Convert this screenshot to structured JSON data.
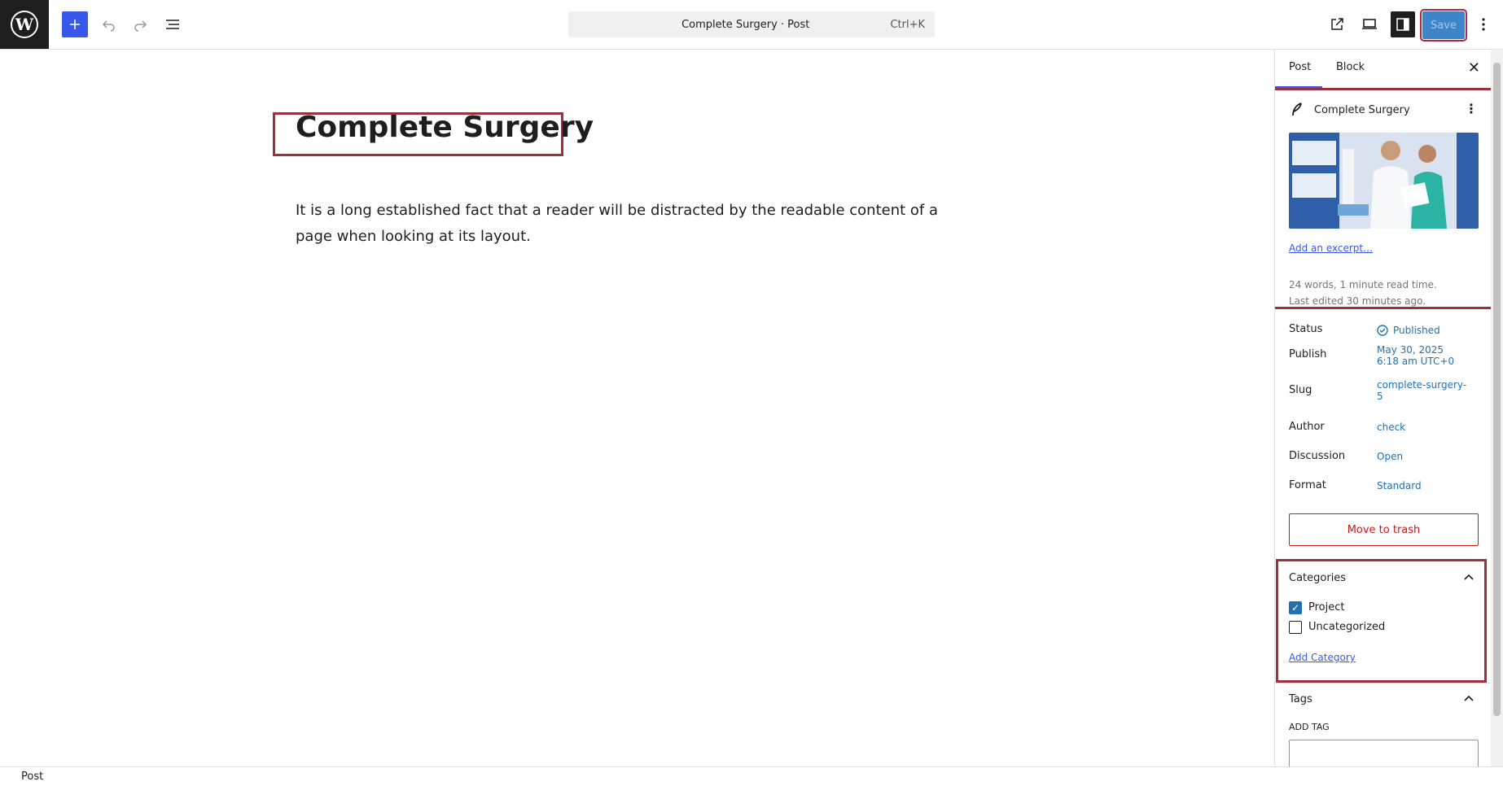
{
  "toolbar": {
    "document_title": "Complete Surgery · Post",
    "shortcut": "Ctrl+K",
    "save_label": "Save"
  },
  "editor": {
    "post_title": "Complete Surgery",
    "paragraph": "It is a long established fact that a reader will be distracted by the readable content of a page when looking at its layout."
  },
  "sidebar": {
    "tabs": [
      {
        "label": "Post"
      },
      {
        "label": "Block"
      }
    ],
    "summary": {
      "title": "Complete Surgery",
      "excerpt_link": "Add an excerpt…",
      "word_count": "24 words, 1 minute read time.",
      "last_edited": "Last edited 30 minutes ago."
    },
    "rows": [
      {
        "label": "Status",
        "value": "Published"
      },
      {
        "label": "Publish",
        "value": "May 30, 2025",
        "value2": "6:18 am UTC+0"
      },
      {
        "label": "Slug",
        "value": "complete-surgery-",
        "value2": "5"
      },
      {
        "label": "Author",
        "value": "check"
      },
      {
        "label": "Discussion",
        "value": "Open"
      },
      {
        "label": "Format",
        "value": "Standard"
      }
    ],
    "trash_label": "Move to trash",
    "categories": {
      "title": "Categories",
      "items": [
        {
          "label": "Project",
          "checked": true
        },
        {
          "label": "Uncategorized",
          "checked": false
        }
      ],
      "add_label": "Add Category"
    },
    "tags": {
      "title": "Tags",
      "add_label": "ADD TAG"
    }
  },
  "footer": {
    "breadcrumb": "Post"
  },
  "colors": {
    "accent": "#3858e9",
    "link": "#2271b1",
    "danger": "#cc1818",
    "highlight_border": "#9d2f3f"
  }
}
